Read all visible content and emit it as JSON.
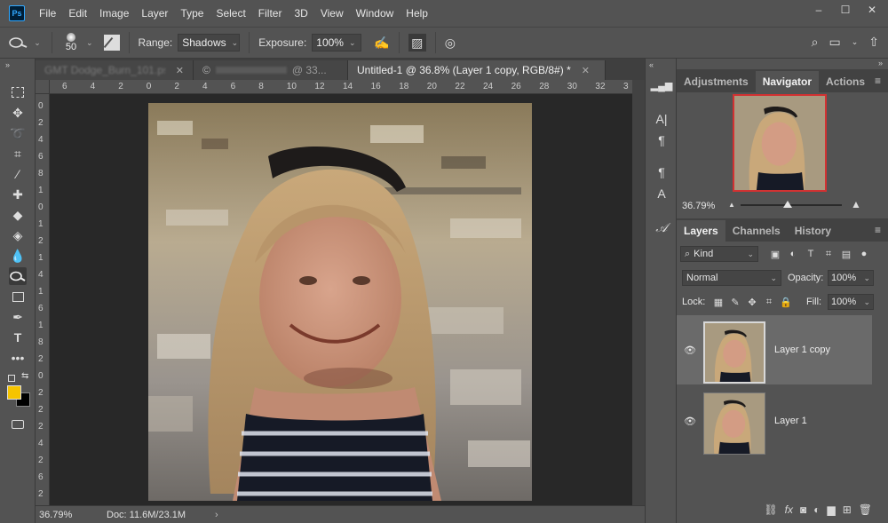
{
  "app": {
    "logo_text": "Ps"
  },
  "menu": [
    "File",
    "Edit",
    "Image",
    "Layer",
    "Type",
    "Select",
    "Filter",
    "3D",
    "View",
    "Window",
    "Help"
  ],
  "window_controls": {
    "minimize": "–",
    "maximize": "☐",
    "close": "✕"
  },
  "options_bar": {
    "brush_size": "50",
    "range_label": "Range:",
    "range_value": "Shadows",
    "exposure_label": "Exposure:",
    "exposure_value": "100%"
  },
  "doc_tabs": [
    {
      "label": "GMT Dodge_Burn_101.ps...",
      "active": false
    },
    {
      "label": "@ 33...",
      "active": false
    },
    {
      "label": "Untitled-1 @ 36.8% (Layer 1 copy, RGB/8#) *",
      "active": true
    }
  ],
  "ruler_h": [
    "6",
    "4",
    "2",
    "0",
    "2",
    "4",
    "6",
    "8",
    "10",
    "12",
    "14",
    "16",
    "18",
    "20",
    "22",
    "24",
    "26",
    "28",
    "30",
    "32",
    "3"
  ],
  "ruler_v": [
    "0",
    "2",
    "4",
    "6",
    "8",
    "1",
    "0",
    "1",
    "2",
    "1",
    "4",
    "1",
    "6",
    "1",
    "8",
    "2",
    "0",
    "2",
    "2",
    "2",
    "4",
    "2",
    "6",
    "2"
  ],
  "status": {
    "zoom": "36.79%",
    "doc": "Doc: 11.6M/23.1M",
    "arrow": "›"
  },
  "colors": {
    "foreground": "#f5c400",
    "background": "#000000",
    "nav_frame": "#d23232"
  },
  "panels": {
    "top_tabs": [
      "Adjustments",
      "Navigator",
      "Actions"
    ],
    "active_top": "Navigator",
    "nav_zoom": "36.79%",
    "layer_tabs": [
      "Layers",
      "Channels",
      "History"
    ],
    "active_layer_tab": "Layers",
    "kind_label": "Kind",
    "blend_mode": "Normal",
    "opacity_label": "Opacity:",
    "opacity_value": "100%",
    "lock_label": "Lock:",
    "fill_label": "Fill:",
    "fill_value": "100%",
    "layers": [
      {
        "name": "Layer 1 copy",
        "selected": true
      },
      {
        "name": "Layer 1",
        "selected": false
      }
    ]
  }
}
